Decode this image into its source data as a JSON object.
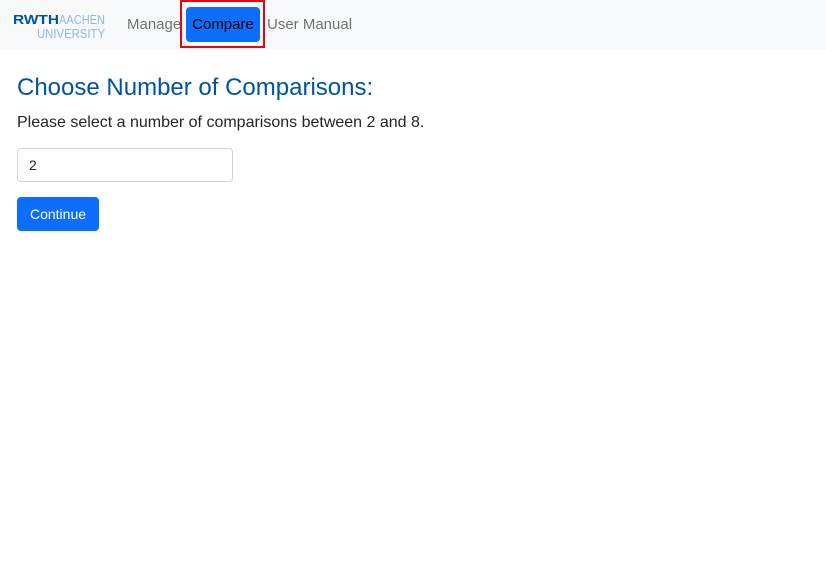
{
  "navbar": {
    "logo": {
      "line1_bold": "RWTH",
      "line1_light": "AACHEN",
      "line2": "UNIVERSITY",
      "colors": {
        "dark": "#00549f",
        "light": "#8ebae5"
      }
    },
    "links": [
      {
        "label": "Manage",
        "active": false
      },
      {
        "label": "Compare",
        "active": true
      },
      {
        "label": "User Manual",
        "active": false
      }
    ],
    "active_color": "#0d6efd",
    "highlight_outline_color": "#e30613"
  },
  "main": {
    "title": "Choose Number of Comparisons:",
    "instruction": "Please select a number of comparisons between 2 and 8.",
    "count_input": {
      "value": "2",
      "min": "2",
      "max": "8"
    },
    "continue_label": "Continue"
  }
}
